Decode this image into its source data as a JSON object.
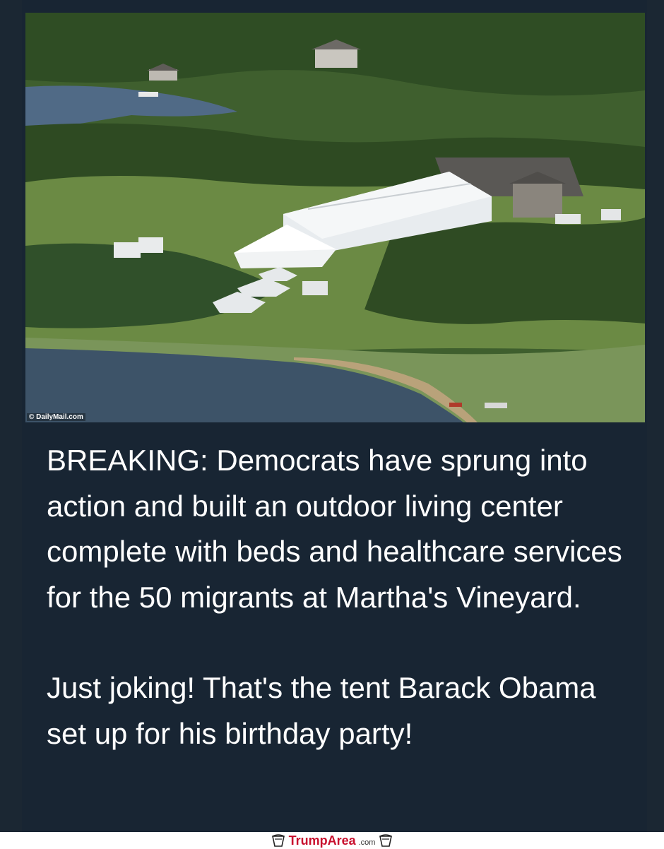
{
  "photo": {
    "credit": "© DailyMail.com"
  },
  "message": {
    "paragraph1": "BREAKING: Democrats have sprung into action and built an outdoor living center complete with beds and healthcare services for the 50 migrants at Martha's Vineyard.",
    "paragraph2": "Just joking! That's the tent Barack Obama set up for his birthday party!"
  },
  "footer": {
    "brand": "TrumpArea",
    "tld": ".com",
    "icon": "cup-icon"
  },
  "colors": {
    "background": "#17212b",
    "card": "#182533",
    "text": "#ffffff",
    "brand": "#c8102e"
  }
}
